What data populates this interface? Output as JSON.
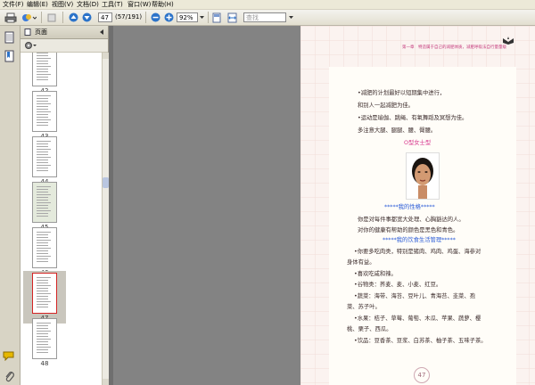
{
  "menu": {
    "file": "文件(F)",
    "edit": "编辑(E)",
    "view": "视图(V)",
    "document": "文档(D)",
    "tools": "工具(T)",
    "window": "窗口(W)",
    "help": "帮助(H)"
  },
  "toolbar": {
    "page_number": "47",
    "page_total": "(57/191)",
    "zoom": "92%",
    "search_placeholder": "查找"
  },
  "sidebar": {
    "title": "页面",
    "pages": [
      "42",
      "43",
      "44",
      "45",
      "46",
      "47",
      "48"
    ],
    "selected_page": "47"
  },
  "page": {
    "header": "第一章　特造属于自己的减肥体质，减肥呼吸法自行量量级",
    "lines": [
      "•减肥的计划最好以短期集中进行，",
      "和别人一起减肥为佳。",
      "•运动是瑜伽、跳绳、有氧舞蹈及冥想为佳。",
      "多注意大腿、腿腿、腰、臀腰。"
    ],
    "face_heading": "O型女士型",
    "personality_heading": "*****我的性格*****",
    "personality_lines": [
      "你是对每件事都宽大处理、心胸豁达的人。",
      "对你的健康有帮助的颜色是黑色和青色。"
    ],
    "diet_heading": "*****我的饮食生活管理*****",
    "diet_lines": [
      "•你要多吃肉类，特别是猪肉、鸡肉、鸡蛋、海参对",
      "身体有益。",
      "•喜欢吃咸和辣。",
      "•谷物类：荞麦、麦、小麦、红豆。",
      "•蔬菜：海带、海苔、豆叶儿、青海苔、韭菜、孢",
      "菜、苏子叶。",
      "•水果：桔子、草莓、葡萄、木瓜、苹果、蔬萝、樱",
      "桃、栗子、西瓜。",
      "•饮品：豆香茶、豆浆、白苏茶、柚子茶、五味子茶。"
    ],
    "page_number": "47"
  },
  "colors": {
    "accent_pink": "#d6338b",
    "accent_blue": "#2a5bd7",
    "doc_background": "#838383",
    "page_background": "#fbf3f0"
  }
}
